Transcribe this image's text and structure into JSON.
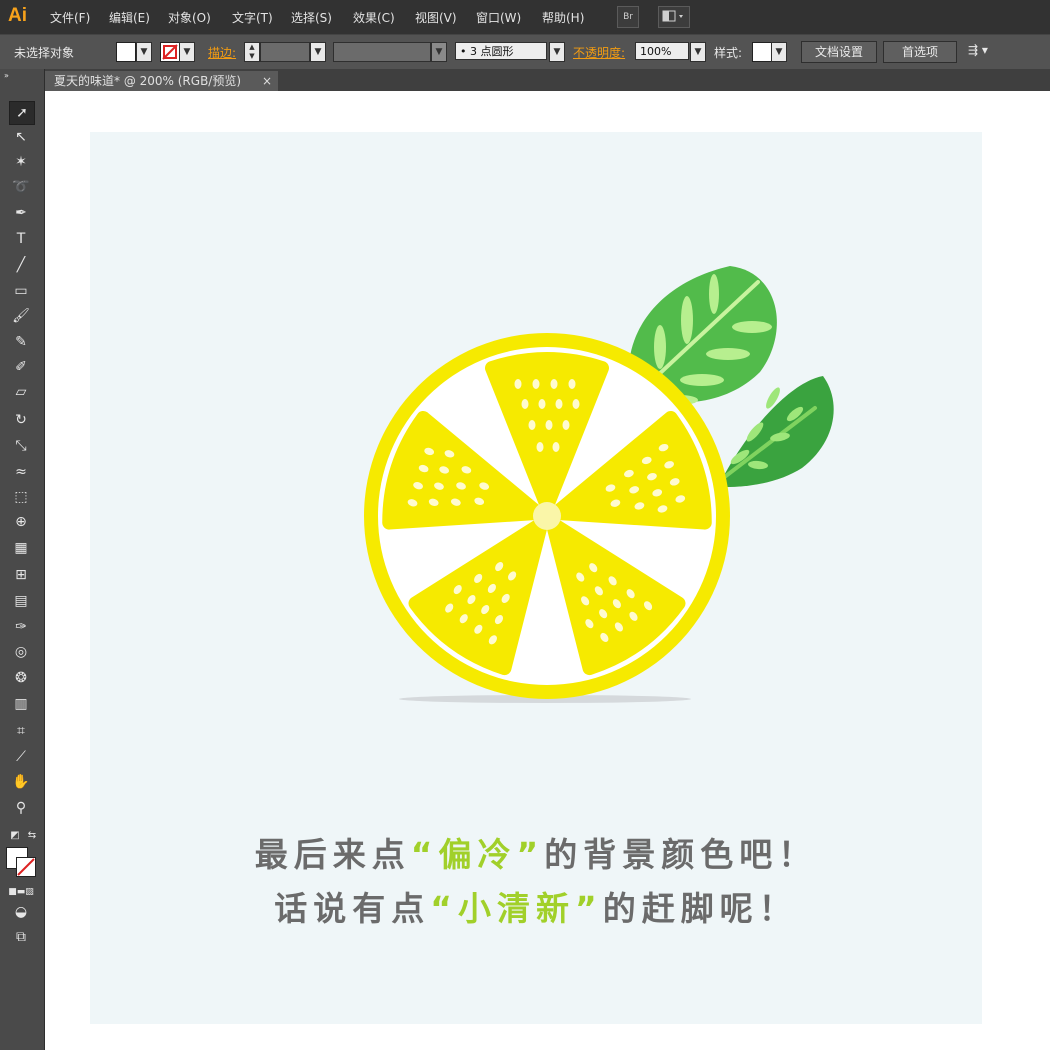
{
  "app": {
    "logo": "Ai"
  },
  "menu": {
    "items": [
      "文件(F)",
      "编辑(E)",
      "对象(O)",
      "文字(T)",
      "选择(S)",
      "效果(C)",
      "视图(V)",
      "窗口(W)",
      "帮助(H)"
    ],
    "bridge_label": "Br"
  },
  "control": {
    "selection_status": "未选择对象",
    "stroke_label": "描边:",
    "brush_label": "3 点圆形",
    "opacity_label": "不透明度:",
    "opacity_value": "100%",
    "style_label": "样式:",
    "doc_setup": "文档设置",
    "preferences": "首选项"
  },
  "document": {
    "tab_title": "夏天的味道* @ 200% (RGB/预览)",
    "close_glyph": "×"
  },
  "artwork": {
    "caption": [
      {
        "before": "最后来点",
        "highlight": "“偏冷”",
        "after": "的背景颜色吧！"
      },
      {
        "before": "话说有点",
        "highlight": "“小清新”",
        "after": "的赶脚呢！"
      }
    ]
  },
  "colors": {
    "accent_highlight": "#a1d02a",
    "artboard_bg": "#eff6f8",
    "lemon": "#f6ea00",
    "leaf_dark": "#3aa33f",
    "leaf_light": "#52bb4b",
    "vein": "#b7ef8f"
  }
}
